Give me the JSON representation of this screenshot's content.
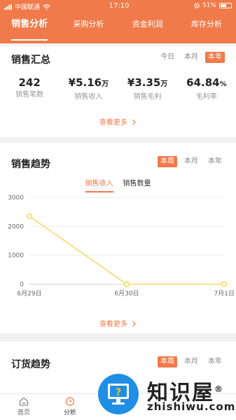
{
  "status": {
    "carrier": "中国联通",
    "time": "17:10",
    "battery": "51%"
  },
  "tabs": [
    {
      "label": "销售分析",
      "active": true
    },
    {
      "label": "采购分析",
      "active": false
    },
    {
      "label": "资金利润",
      "active": false
    },
    {
      "label": "库存分析",
      "active": false
    }
  ],
  "sales_summary": {
    "title": "销售汇总",
    "periods": [
      "今日",
      "本月",
      "本年"
    ],
    "active_period": "本年",
    "stats": [
      {
        "value": "242",
        "unit": "",
        "label": "销售笔数"
      },
      {
        "value": "¥5.16",
        "unit": "万",
        "label": "销售收入"
      },
      {
        "value": "¥3.35",
        "unit": "万",
        "label": "销售毛利"
      },
      {
        "value": "64.84",
        "unit": "%",
        "label": "毛利率"
      }
    ],
    "more": "查看更多"
  },
  "sales_trend": {
    "title": "销售趋势",
    "periods": [
      "本周",
      "本月",
      "本年"
    ],
    "active_period": "本周",
    "subtabs": [
      "销售收入",
      "销售数量"
    ],
    "active_subtab": "销售收入",
    "more": "查看更多"
  },
  "chart_data": {
    "type": "line",
    "categories": [
      "6月29日",
      "6月30日",
      "7月1日"
    ],
    "series": [
      {
        "name": "销售收入",
        "values": [
          2350,
          0,
          0
        ]
      }
    ],
    "yticks": [
      0,
      1000,
      2000,
      3000
    ],
    "ylim": [
      0,
      3000
    ],
    "color": "#f5d14a",
    "grid": true
  },
  "order_trend": {
    "title": "订货趋势",
    "periods": [
      "本周",
      "本月",
      "本年"
    ],
    "active_period": "本周"
  },
  "bottom_nav": [
    {
      "label": "首页",
      "icon": "home-icon"
    },
    {
      "label": "分析",
      "icon": "clock-icon",
      "active": true
    }
  ],
  "watermark": {
    "text": "知识屋",
    "sub": "zhishiwu.com",
    "mark": "®"
  },
  "colors": {
    "accent": "#f07a4a",
    "line": "#f5d14a",
    "badge": "#1f8fe6"
  }
}
